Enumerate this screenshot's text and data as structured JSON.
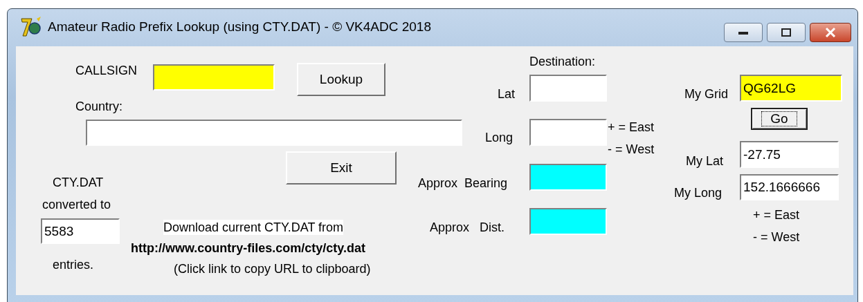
{
  "window": {
    "title": "Amateur Radio Prefix Lookup (using CTY.DAT) - © VK4ADC 2018"
  },
  "labels": [
    {
      "text": "CALLSIGN",
      "highlighted": false
    },
    {
      "text": "Country:",
      "highlighted": false
    },
    {
      "text": "CTY.DAT",
      "highlighted": false
    },
    {
      "text": "converted to",
      "highlighted": false
    },
    {
      "text": "entries.",
      "highlighted": false
    },
    {
      "text": "Download current CTY.DAT from",
      "highlighted": true
    },
    {
      "text": "(Click link to copy URL to clipboard)",
      "highlighted": false
    },
    {
      "text": "Destination:",
      "highlighted": false
    },
    {
      "text": "Lat",
      "highlighted": false
    },
    {
      "text": "Long",
      "highlighted": false
    },
    {
      "text": "+ = East",
      "highlighted": false
    },
    {
      "text": "- = West",
      "highlighted": false
    },
    {
      "text": "Approx  Bearing",
      "highlighted": false
    },
    {
      "text": "Approx   Dist.",
      "highlighted": false
    },
    {
      "text": "My Grid",
      "highlighted": false
    },
    {
      "text": "My Lat",
      "highlighted": false
    },
    {
      "text": "My Long",
      "highlighted": false
    },
    {
      "text": "+ = East",
      "highlighted": false
    },
    {
      "text": "- = West",
      "highlighted": false
    }
  ],
  "link": "http://www.country-files.com/cty/cty.dat",
  "fields": [
    {
      "color": "#ffff00"
    },
    {
      "color": "#ffffff"
    },
    {
      "value": "5583",
      "color": "#ffffff"
    },
    {
      "color": "#ffffff"
    },
    {
      "color": "#ffffff"
    },
    {
      "color": "#00ffff"
    },
    {
      "color": "#00ffff"
    },
    {
      "value": "QG62LG",
      "color": "#ffff00"
    },
    {
      "value": "-27.75",
      "color": "#ffffff"
    },
    {
      "value": "152.1666666",
      "color": "#ffffff"
    }
  ],
  "buttons": [
    {
      "label": "Lookup",
      "focused": false
    },
    {
      "label": "Exit",
      "focused": false
    },
    {
      "label": "Go",
      "focused": true
    }
  ]
}
